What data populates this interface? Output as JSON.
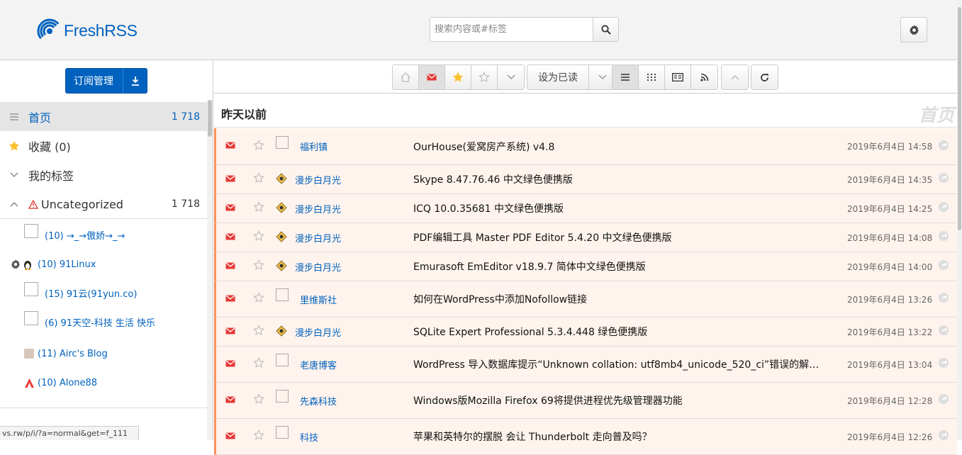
{
  "app": {
    "name": "FreshRSS",
    "brand_color": "#0062be",
    "unread_accent": "#ff8f59"
  },
  "search": {
    "placeholder": "搜索内容或#标签"
  },
  "aside": {
    "subscribe_label": "订阅管理",
    "nav": [
      {
        "label": "首页",
        "count": "1 718",
        "icon": "bars-icon"
      },
      {
        "label": "收藏 (0)",
        "count": "",
        "icon": "star-icon"
      },
      {
        "label": "我的标签",
        "count": "",
        "icon": "chevron-down-icon"
      },
      {
        "label": "Uncategorized",
        "count": "1 718",
        "icon": "warning-icon"
      }
    ],
    "feeds": [
      "(10) →_→傲娇→_→",
      "(10) 91Linux",
      "(15) 91云(91yun.co)",
      "(6) 91天空-科技 生活 快乐",
      "(11) Airc's Blog",
      "(10) Alone88"
    ]
  },
  "status_url": "vs.rw/p/i/?a=normal&get=f_111",
  "toolbar": {
    "mark_read_label": "设为已读"
  },
  "day_header": {
    "label": "昨天以前",
    "watermark": "首页"
  },
  "articles": [
    {
      "source": "福利镇",
      "title": "OurHouse(爱窝房产系统) v4.8",
      "date": "2019年6月4日 14:58"
    },
    {
      "source": "漫步白月光",
      "title": "Skype 8.47.76.46 中文绿色便携版",
      "date": "2019年6月4日 14:35"
    },
    {
      "source": "漫步白月光",
      "title": "ICQ 10.0.35681 中文绿色便携版",
      "date": "2019年6月4日 14:25"
    },
    {
      "source": "漫步白月光",
      "title": "PDF编辑工具 Master PDF Editor 5.4.20 中文绿色便携版",
      "date": "2019年6月4日 14:08"
    },
    {
      "source": "漫步白月光",
      "title": "Emurasoft EmEditor v18.9.7 简体中文绿色便携版",
      "date": "2019年6月4日 14:00"
    },
    {
      "source": "里维斯社",
      "title": "如何在WordPress中添加Nofollow链接",
      "date": "2019年6月4日 13:26"
    },
    {
      "source": "漫步白月光",
      "title": "SQLite Expert Professional 5.3.4.448 绿色便携版",
      "date": "2019年6月4日 13:22"
    },
    {
      "source": "老唐博客",
      "title": "WordPress 导入数据库提示“Unknown collation: utf8mb4_unicode_520_ci”错误的解决...",
      "date": "2019年6月4日 13:04"
    },
    {
      "source": "先森科技",
      "title": "Windows版Mozilla Firefox 69将提供进程优先级管理器功能",
      "date": "2019年6月4日 12:28"
    },
    {
      "source": "科技",
      "title": "苹果和英特尔的摆脱 会让 Thunderbolt 走向普及吗？",
      "date": "2019年6月4日 12:26"
    }
  ]
}
